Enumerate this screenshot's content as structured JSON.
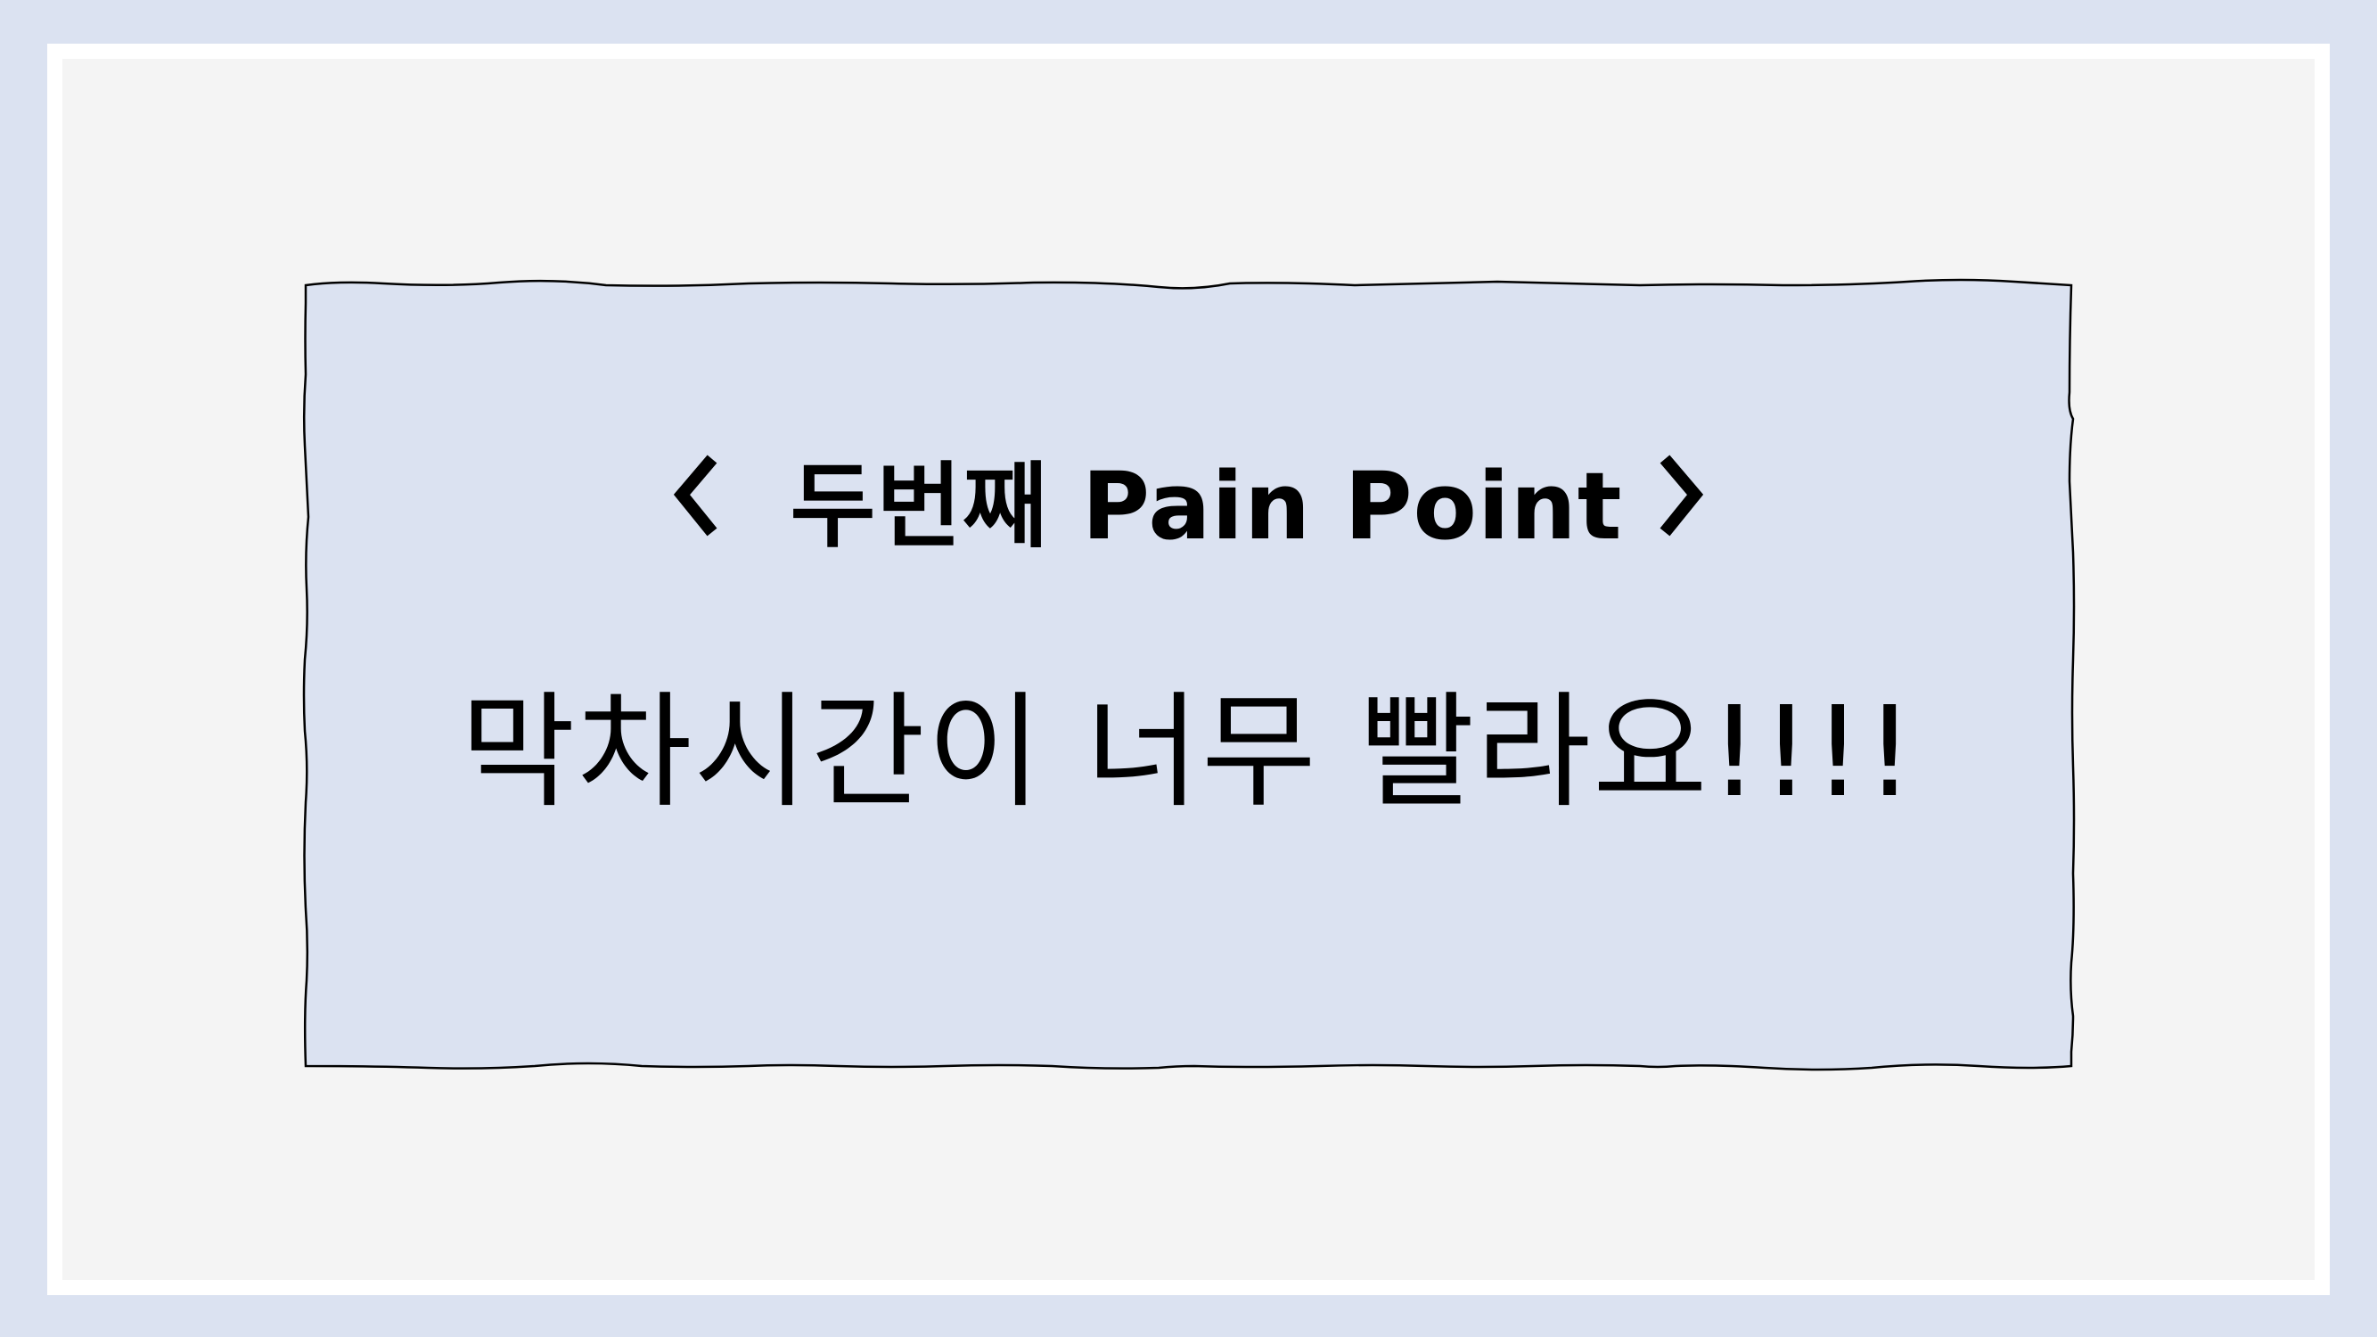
{
  "slide": {
    "title": "두번째 Pain Point",
    "message": "막차시간이 너무 빨라요!!!!"
  },
  "colors": {
    "background": "#dbe2f1",
    "frame": "#ffffff",
    "panel": "#f4f4f4",
    "card_fill": "#dbe2f1",
    "card_stroke": "#000000",
    "text": "#000000"
  },
  "icons": {
    "left": "chevron-left-icon",
    "right": "chevron-right-icon"
  }
}
